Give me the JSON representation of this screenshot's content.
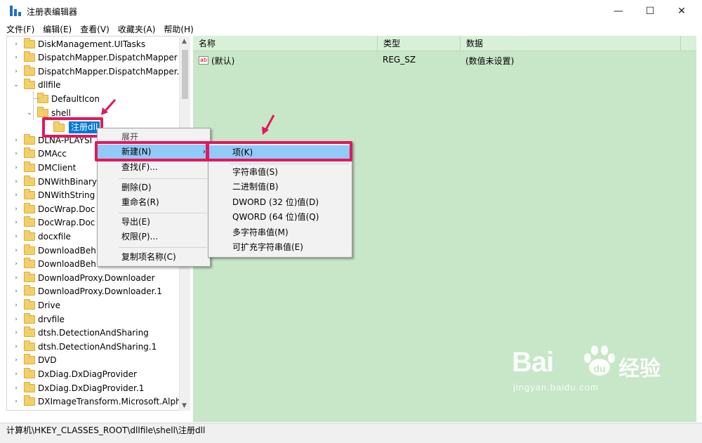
{
  "window": {
    "title": "注册表编辑器",
    "min_glyph": "—",
    "max_glyph": "☐",
    "close_glyph": "✕"
  },
  "menubar": {
    "items": [
      "文件(F)",
      "编辑(E)",
      "查看(V)",
      "收藏夹(A)",
      "帮助(H)"
    ]
  },
  "tree": {
    "items": [
      {
        "label": "DiskManagement.UITasks",
        "arrow": "›",
        "indent": 0
      },
      {
        "label": "DispatchMapper.DispatchMapper",
        "arrow": "›",
        "indent": 0
      },
      {
        "label": "DispatchMapper.DispatchMapper.",
        "arrow": "›",
        "indent": 0
      },
      {
        "label": "dllfile",
        "arrow": "⌄",
        "indent": 0
      },
      {
        "label": "DefaultIcon",
        "arrow": "",
        "indent": 1
      },
      {
        "label": "shell",
        "arrow": "⌄",
        "indent": 1
      },
      {
        "label": "",
        "arrow": "",
        "indent": 2
      },
      {
        "label": "DLNA-PLAYSI",
        "arrow": "›",
        "indent": 0
      },
      {
        "label": "DMAcc",
        "arrow": "›",
        "indent": 0
      },
      {
        "label": "DMClient",
        "arrow": "›",
        "indent": 0
      },
      {
        "label": "DNWithBinary",
        "arrow": "›",
        "indent": 0
      },
      {
        "label": "DNWithString",
        "arrow": "›",
        "indent": 0
      },
      {
        "label": "DocWrap.Doc",
        "arrow": "›",
        "indent": 0
      },
      {
        "label": "DocWrap.Doc",
        "arrow": "›",
        "indent": 0
      },
      {
        "label": "docxfile",
        "arrow": "›",
        "indent": 0
      },
      {
        "label": "DownloadBeh",
        "arrow": "›",
        "indent": 0
      },
      {
        "label": "DownloadBeh",
        "arrow": "›",
        "indent": 0
      },
      {
        "label": "DownloadProxy.Downloader",
        "arrow": "›",
        "indent": 0
      },
      {
        "label": "DownloadProxy.Downloader.1",
        "arrow": "›",
        "indent": 0
      },
      {
        "label": "Drive",
        "arrow": "›",
        "indent": 0
      },
      {
        "label": "drvfile",
        "arrow": "›",
        "indent": 0
      },
      {
        "label": "dtsh.DetectionAndSharing",
        "arrow": "›",
        "indent": 0
      },
      {
        "label": "dtsh.DetectionAndSharing.1",
        "arrow": "›",
        "indent": 0
      },
      {
        "label": "DVD",
        "arrow": "›",
        "indent": 0
      },
      {
        "label": "DxDiag.DxDiagProvider",
        "arrow": "›",
        "indent": 0
      },
      {
        "label": "DxDiag.DxDiagProvider.1",
        "arrow": "›",
        "indent": 0
      },
      {
        "label": "DXImageTransform.Microsoft.Alph",
        "arrow": "›",
        "indent": 0
      }
    ],
    "selected_label": "注册dll"
  },
  "values": {
    "columns": [
      "名称",
      "类型",
      "数据"
    ],
    "rows": [
      {
        "name": "(默认)",
        "type": "REG_SZ",
        "data": "(数值未设置)"
      }
    ],
    "icon_text": "ab"
  },
  "context_menu": {
    "items": [
      "展开",
      "新建(N)",
      "查找(F)...",
      "删除(D)",
      "重命名(R)",
      "导出(E)",
      "权限(P)...",
      "复制项名称(C)"
    ],
    "hover_index": 1
  },
  "submenu": {
    "items": [
      "项(K)",
      "字符串值(S)",
      "二进制值(B)",
      "DWORD (32 位)值(D)",
      "QWORD (64 位)值(Q)",
      "多字符串值(M)",
      "可扩充字符串值(E)"
    ],
    "hover_index": 0
  },
  "statusbar": {
    "path": "计算机\\HKEY_CLASSES_ROOT\\dllfile\\shell\\注册dll"
  },
  "watermark": {
    "bai": "Bai",
    "du": "du",
    "jingyan": "经验",
    "url": "jingyan.baidu.com"
  },
  "colors": {
    "accent": "#0078d7",
    "highlight_box": "#e3175b",
    "values_bg": "#c8e6c8",
    "menu_hover": "#91c9f7"
  }
}
